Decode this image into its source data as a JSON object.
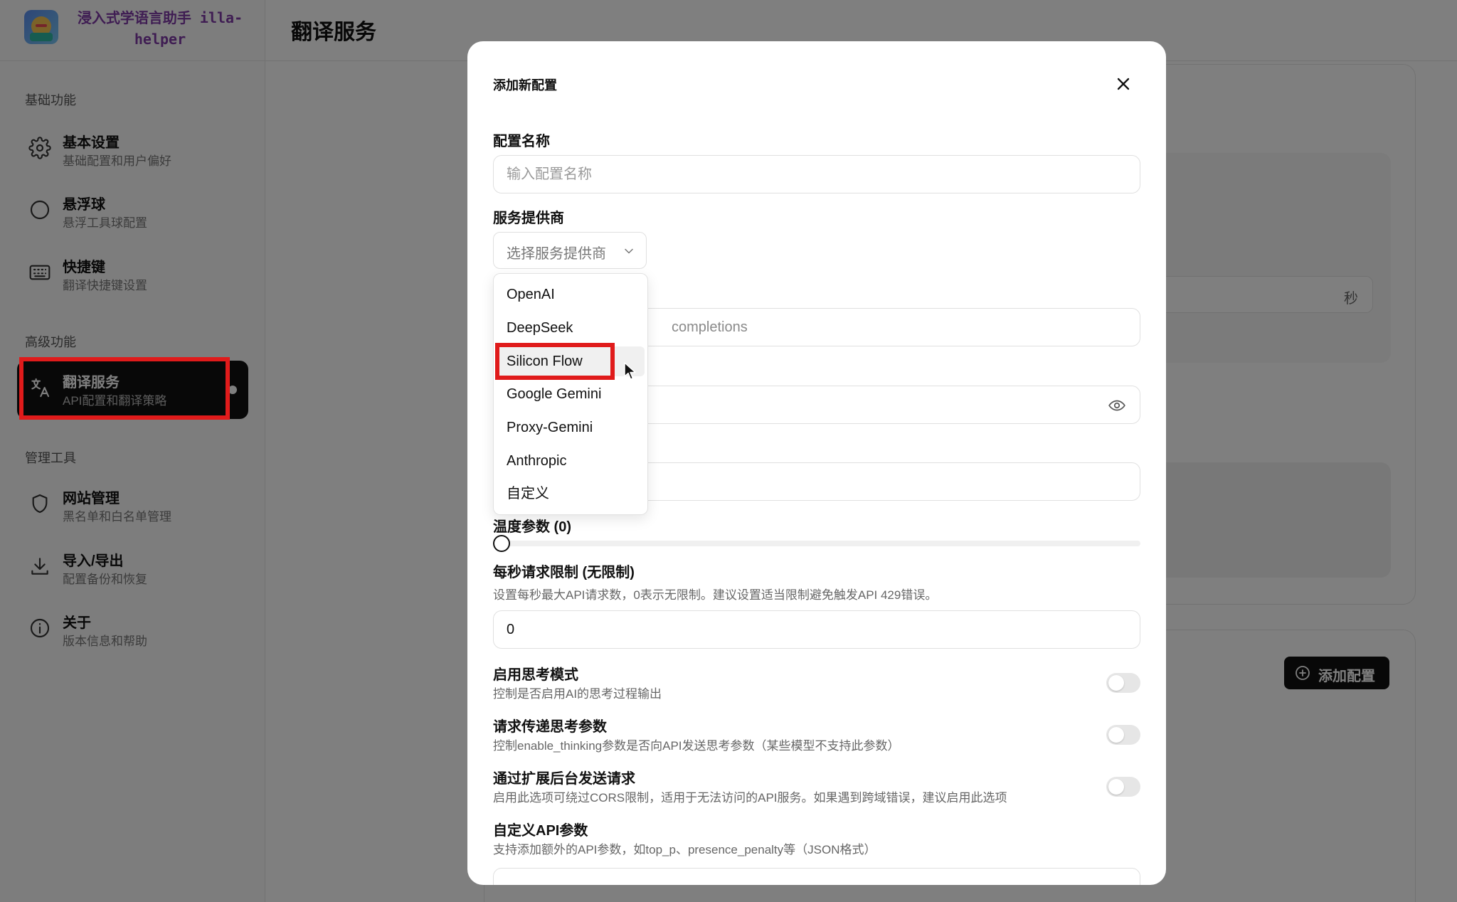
{
  "app": {
    "brand": "浸入式学语言助手 illa-helper",
    "page_title": "翻译服务"
  },
  "sidebar": {
    "sections": [
      {
        "label": "基础功能"
      },
      {
        "label": "高级功能"
      },
      {
        "label": "管理工具"
      }
    ],
    "items": [
      {
        "title": "基本设置",
        "subtitle": "基础配置和用户偏好",
        "icon": "gear-icon"
      },
      {
        "title": "悬浮球",
        "subtitle": "悬浮工具球配置",
        "icon": "circle-icon"
      },
      {
        "title": "快捷键",
        "subtitle": "翻译快捷键设置",
        "icon": "keyboard-icon"
      },
      {
        "title": "翻译服务",
        "subtitle": "API配置和翻译策略",
        "icon": "translate-icon",
        "active": true
      },
      {
        "title": "网站管理",
        "subtitle": "黑名单和白名单管理",
        "icon": "shield-icon"
      },
      {
        "title": "导入/导出",
        "subtitle": "配置备份和恢复",
        "icon": "download-icon"
      },
      {
        "title": "关于",
        "subtitle": "版本信息和帮助",
        "icon": "info-icon"
      }
    ]
  },
  "background": {
    "seconds_unit": "秒",
    "add_config_label": "添加配置",
    "add_config_icon": "plus-circle-icon"
  },
  "modal": {
    "title": "添加新配置",
    "close_icon": "close-icon",
    "config_name": {
      "label": "配置名称",
      "placeholder": "输入配置名称",
      "value": ""
    },
    "provider": {
      "label": "服务提供商",
      "placeholder": "选择服务提供商",
      "options": [
        "OpenAI",
        "DeepSeek",
        "Silicon Flow",
        "Google Gemini",
        "Proxy-Gemini",
        "Anthropic",
        "自定义"
      ],
      "hovered": "Silicon Flow"
    },
    "endpoint_visible_fragment": "completions",
    "api_key_icon": "eye-icon",
    "temperature": {
      "label": "温度参数 (0)",
      "value": 0
    },
    "rate_limit": {
      "label": "每秒请求限制 (无限制)",
      "help": "设置每秒最大API请求数，0表示无限制。建议设置适当限制避免触发API 429错误。",
      "value": "0"
    },
    "toggles": [
      {
        "label": "启用思考模式",
        "help": "控制是否启用AI的思考过程输出",
        "on": false
      },
      {
        "label": "请求传递思考参数",
        "help": "控制enable_thinking参数是否向API发送思考参数（某些模型不支持此参数）",
        "on": false
      },
      {
        "label": "通过扩展后台发送请求",
        "help": "启用此选项可绕过CORS限制，适用于无法访问的API服务。如果遇到跨域错误，建议启用此选项",
        "on": false
      }
    ],
    "custom_params": {
      "label": "自定义API参数",
      "help": "支持添加额外的API参数，如top_p、presence_penalty等（JSON格式）"
    }
  },
  "colors": {
    "highlight": "#e01b1b",
    "active_nav_bg": "#111111",
    "brand_text": "#7f3aa6",
    "overlay": "rgba(0,0,0,0.5)"
  }
}
